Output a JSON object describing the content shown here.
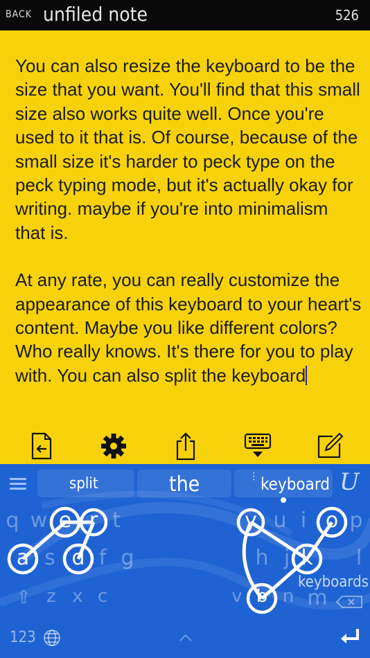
{
  "header": {
    "back_label": "BACK",
    "title": "unfiled note",
    "count": "526"
  },
  "note": {
    "paragraph1": "You can also resize the keyboard to be the size that you want. You'll find that this small size also works quite well. Once you're used to it that is. Of course, because of the small size it's harder to peck type on the peck typing mode, but it's actually okay for writing. maybe if you're into minimalism that is.",
    "paragraph2": "At any rate, you can really customize the appearance of this keyboard to your heart's content. Maybe you like different colors? Who really knows. It's there for you to play with. You can also split the keyboard"
  },
  "toolbar": {
    "icons": [
      "back-arrow-doc-icon",
      "gear-icon",
      "share-icon",
      "keyboard-down-icon",
      "edit-icon"
    ]
  },
  "keyboard": {
    "suggestions": {
      "left": "split",
      "center": "the",
      "right": "keyboard"
    },
    "ghost_suggestion": "keyboards",
    "logo": "U",
    "left_rows": [
      [
        "q",
        "w",
        "e",
        "r",
        "t"
      ],
      [
        "a",
        "s",
        "d",
        "f",
        "g"
      ],
      [
        "z",
        "x",
        "c"
      ]
    ],
    "right_rows": [
      [
        "y",
        "u",
        "i",
        "o",
        "p"
      ],
      [
        "h",
        "j",
        "k",
        "l"
      ],
      [
        "v",
        "b",
        "n",
        "m"
      ]
    ],
    "number_key": "123",
    "colors": {
      "keyboard_bg": "#1f63d3",
      "note_bg": "#f7d20a",
      "header_bg": "#0a0a0a"
    }
  }
}
